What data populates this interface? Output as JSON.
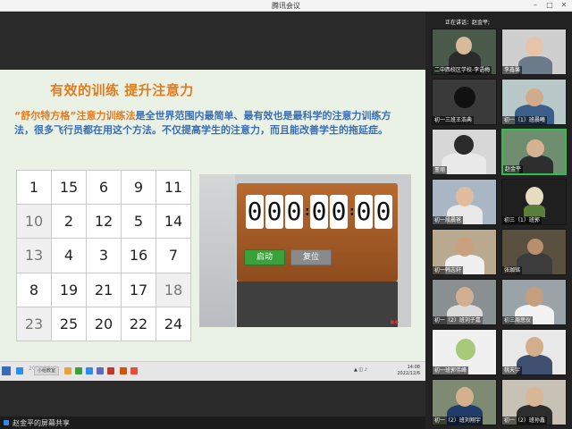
{
  "window": {
    "title": "腾讯会议"
  },
  "slide": {
    "title": "有效的训练  提升注意力",
    "para_highlight": "“舒尔特方格”注意力训练法",
    "para_rest": "是全世界范围内最简单、最有效也是最科学的注意力训练方法，很多飞行员都在用这个方法。不仅提高学生的注意力，而且能改善学生的拖延症。"
  },
  "grid": {
    "rows": [
      [
        "1",
        "15",
        "6",
        "9",
        "11"
      ],
      [
        "10",
        "2",
        "12",
        "5",
        "14"
      ],
      [
        "13",
        "4",
        "3",
        "16",
        "7"
      ],
      [
        "8",
        "19",
        "21",
        "17",
        "18"
      ],
      [
        "23",
        "25",
        "20",
        "22",
        "24"
      ]
    ]
  },
  "timer": {
    "digits": [
      "0",
      "0",
      "0",
      "0",
      "0",
      "0",
      "0"
    ],
    "start_label": "启动",
    "reset_label": "复位"
  },
  "taskbar": {
    "date_overlay": "2022-12-6",
    "app_label": "小组教室",
    "clock_time": "14:08",
    "clock_date": "2022/12/6"
  },
  "status": {
    "sharing_label": "赵金平的屏幕共享"
  },
  "gallery": {
    "speaking_label": "正在讲话：赵金平;",
    "tiles": [
      {
        "name": "二中西校区学校-李语梅"
      },
      {
        "name": "李鑫馨"
      },
      {
        "name": "初一三班王浩典"
      },
      {
        "name": "初一（1）班晨曦"
      },
      {
        "name": "董丽"
      },
      {
        "name": "赵金平"
      },
      {
        "name": "初一段晨爸"
      },
      {
        "name": "初三（1）班郭"
      },
      {
        "name": "初一韩志轩"
      },
      {
        "name": "张珈铭"
      },
      {
        "name": "初一（2）班刘子嘉"
      },
      {
        "name": "初三周思仪"
      },
      {
        "name": "初一班郭伟峰"
      },
      {
        "name": "桃天宇"
      },
      {
        "name": "初一（2）班刘翔宇"
      },
      {
        "name": "初一（2）班孙鑫"
      }
    ]
  }
}
